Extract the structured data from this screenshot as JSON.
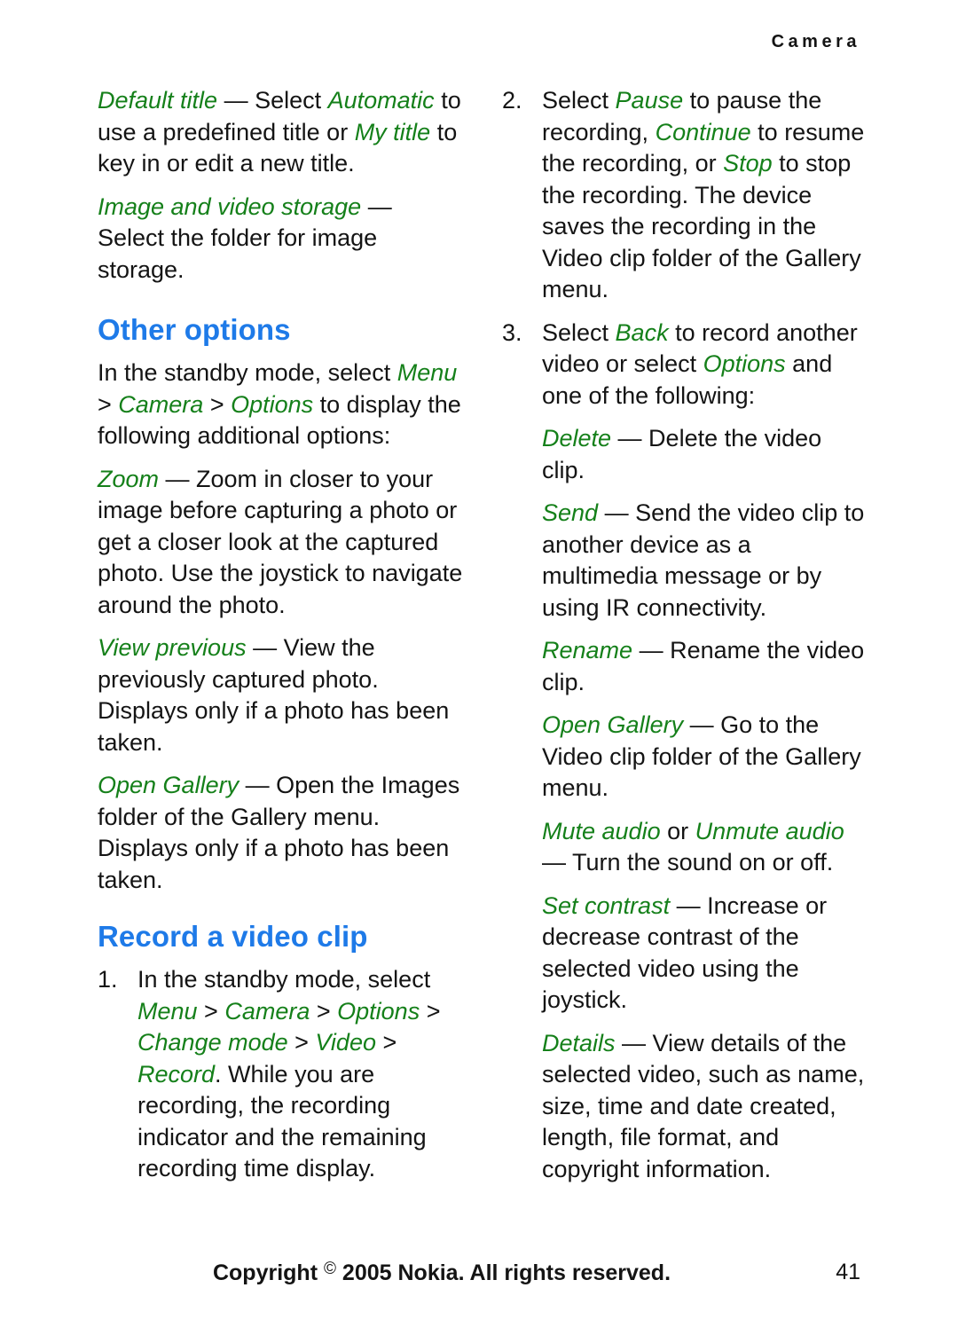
{
  "header": {
    "running_head": "Camera"
  },
  "left_column": {
    "paragraphs": [
      {
        "id": "default-title",
        "runs": [
          {
            "text": "Default title",
            "style": "ui-term"
          },
          {
            "text": " — Select ",
            "style": "plain"
          },
          {
            "text": "Automatic",
            "style": "ui-term"
          },
          {
            "text": " to use a predefined title or ",
            "style": "plain"
          },
          {
            "text": "My title",
            "style": "ui-term"
          },
          {
            "text": " to key in or edit a new title.",
            "style": "plain"
          }
        ]
      },
      {
        "id": "image-and-video-storage",
        "runs": [
          {
            "text": "Image and video storage",
            "style": "ui-term"
          },
          {
            "text": " — Select the folder for image storage.",
            "style": "plain"
          }
        ]
      }
    ],
    "heading_other_options": "Other options",
    "other_options_intro": {
      "id": "other-options-intro",
      "runs": [
        {
          "text": "In the standby mode, select ",
          "style": "plain"
        },
        {
          "text": "Menu",
          "style": "ui-term"
        },
        {
          "text": " > ",
          "style": "sep"
        },
        {
          "text": "Camera",
          "style": "ui-term"
        },
        {
          "text": " > ",
          "style": "sep"
        },
        {
          "text": "Options",
          "style": "ui-term"
        },
        {
          "text": " to display the following additional options:",
          "style": "plain"
        }
      ]
    },
    "option_paragraphs": [
      {
        "id": "zoom-option",
        "runs": [
          {
            "text": "Zoom",
            "style": "ui-term"
          },
          {
            "text": " — Zoom in closer to your image before capturing a photo or get a closer look at the captured photo. Use the joystick to navigate around the photo.",
            "style": "plain"
          }
        ]
      },
      {
        "id": "view-previous-option",
        "runs": [
          {
            "text": "View previous",
            "style": "ui-term"
          },
          {
            "text": " — View the previously captured photo. Displays only if a photo has been taken.",
            "style": "plain"
          }
        ]
      },
      {
        "id": "open-gallery-option",
        "runs": [
          {
            "text": "Open Gallery",
            "style": "ui-term"
          },
          {
            "text": " — Open the Images folder of the Gallery menu. Displays only if a photo has been taken.",
            "style": "plain"
          }
        ]
      }
    ],
    "heading_record_video": "Record a video clip",
    "step_1": {
      "number": "1.",
      "runs": [
        {
          "text": "In the standby mode, select ",
          "style": "plain"
        },
        {
          "text": "Menu",
          "style": "ui-term"
        },
        {
          "text": " > ",
          "style": "sep"
        },
        {
          "text": "Camera",
          "style": "ui-term"
        },
        {
          "text": " > ",
          "style": "sep"
        },
        {
          "text": "Options",
          "style": "ui-term"
        },
        {
          "text": " > ",
          "style": "sep"
        },
        {
          "text": "Change mode",
          "style": "ui-term"
        },
        {
          "text": " > ",
          "style": "sep"
        },
        {
          "text": "Video",
          "style": "ui-term"
        },
        {
          "text": " > ",
          "style": "sep"
        },
        {
          "text": "Record",
          "style": "ui-term"
        },
        {
          "text": ". While you are recording, the recording indicator and the remaining recording time display.",
          "style": "plain"
        }
      ]
    }
  },
  "right_column": {
    "step_2": {
      "number": "2.",
      "runs": [
        {
          "text": "Select ",
          "style": "plain"
        },
        {
          "text": "Pause",
          "style": "ui-term"
        },
        {
          "text": " to pause the recording, ",
          "style": "plain"
        },
        {
          "text": "Continue",
          "style": "ui-term"
        },
        {
          "text": " to resume the recording, or ",
          "style": "plain"
        },
        {
          "text": "Stop",
          "style": "ui-term"
        },
        {
          "text": " to stop the recording. The device saves the recording in the Video clip folder of the Gallery menu.",
          "style": "plain"
        }
      ]
    },
    "step_3": {
      "number": "3.",
      "runs": [
        {
          "text": "Select ",
          "style": "plain"
        },
        {
          "text": "Back",
          "style": "ui-term"
        },
        {
          "text": " to record another video or select ",
          "style": "plain"
        },
        {
          "text": "Options",
          "style": "ui-term"
        },
        {
          "text": " and one of the following:",
          "style": "plain"
        }
      ]
    },
    "step_3_options": [
      {
        "id": "delete-option",
        "runs": [
          {
            "text": "Delete",
            "style": "ui-term"
          },
          {
            "text": " — Delete the video clip.",
            "style": "plain"
          }
        ]
      },
      {
        "id": "send-option",
        "runs": [
          {
            "text": "Send",
            "style": "ui-term"
          },
          {
            "text": " — Send the video clip to another device as a multimedia message or by using IR connectivity.",
            "style": "plain"
          }
        ]
      },
      {
        "id": "rename-option",
        "runs": [
          {
            "text": "Rename",
            "style": "ui-term"
          },
          {
            "text": " — Rename the video clip.",
            "style": "plain"
          }
        ]
      },
      {
        "id": "open-gallery-video-option",
        "runs": [
          {
            "text": "Open Gallery",
            "style": "ui-term"
          },
          {
            "text": " — Go to the Video clip folder of the Gallery menu.",
            "style": "plain"
          }
        ]
      },
      {
        "id": "mute-audio-option",
        "runs": [
          {
            "text": "Mute audio",
            "style": "ui-term"
          },
          {
            "text": " or ",
            "style": "plain"
          },
          {
            "text": "Unmute audio",
            "style": "ui-term"
          },
          {
            "text": " — Turn the sound on or off.",
            "style": "plain"
          }
        ]
      },
      {
        "id": "set-contrast-option",
        "runs": [
          {
            "text": "Set contrast",
            "style": "ui-term"
          },
          {
            "text": " — Increase or decrease contrast of the selected video using the joystick.",
            "style": "plain"
          }
        ]
      },
      {
        "id": "details-option",
        "runs": [
          {
            "text": "Details",
            "style": "ui-term"
          },
          {
            "text": " — View details of the selected video, such as name, size, time and date created, length, file format, and copyright information.",
            "style": "plain"
          }
        ]
      }
    ]
  },
  "footer": {
    "copyright_before": "Copyright ",
    "copyright_symbol": "©",
    "copyright_after": " 2005 Nokia. All rights reserved.",
    "page_number": "41"
  },
  "colors": {
    "ui_term_green": "#15801A",
    "heading_blue": "#1E7AE8",
    "body_black": "#141414",
    "page_background": "#FFFFFF"
  }
}
